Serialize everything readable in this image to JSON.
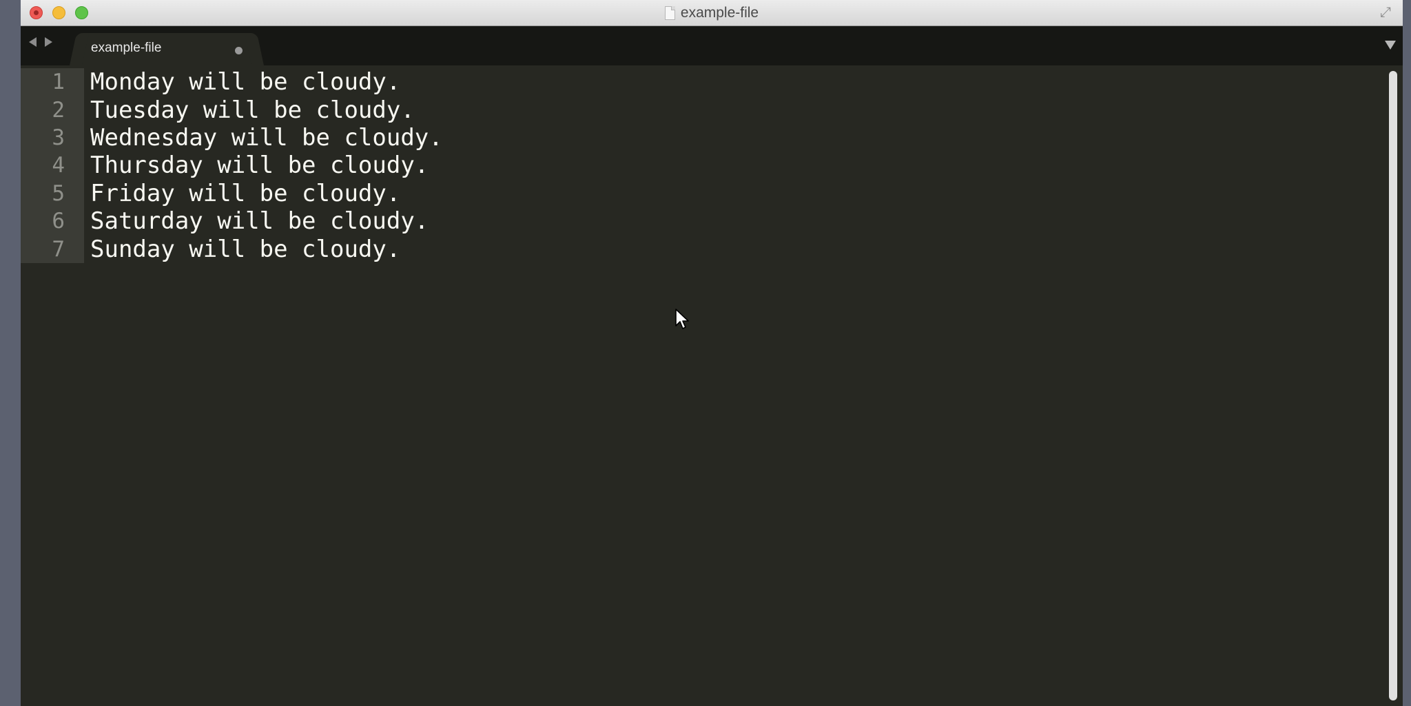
{
  "window": {
    "title": "example-file"
  },
  "tab": {
    "label": "example-file"
  },
  "editor": {
    "lines": [
      {
        "number": "1",
        "text": "Monday will be cloudy."
      },
      {
        "number": "2",
        "text": "Tuesday will be cloudy."
      },
      {
        "number": "3",
        "text": "Wednesday will be cloudy."
      },
      {
        "number": "4",
        "text": "Thursday will be cloudy."
      },
      {
        "number": "5",
        "text": "Friday will be cloudy."
      },
      {
        "number": "6",
        "text": "Saturday will be cloudy."
      },
      {
        "number": "7",
        "text": "Sunday will be cloudy."
      }
    ]
  },
  "colors": {
    "editor_background": "#272822",
    "gutter_background": "#3b3c36",
    "text": "#f8f8f2",
    "line_number": "#8f908a"
  }
}
